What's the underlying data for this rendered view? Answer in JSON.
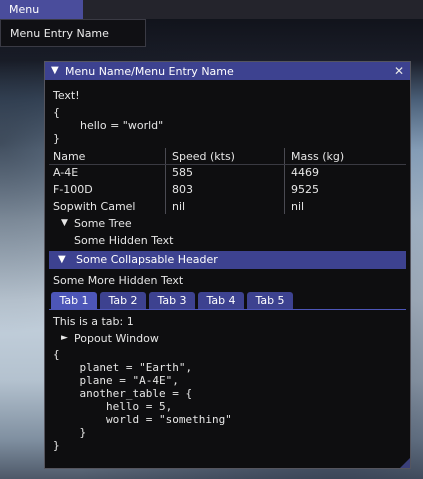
{
  "menubar": {
    "menu_title": "Menu Name",
    "entry": "Menu Entry Name"
  },
  "window": {
    "title": "Menu Name/Menu Entry Name",
    "close_glyph": "✕",
    "text_label": "Text!",
    "hello_block": {
      "open": "{",
      "line": "hello = \"world\"",
      "close": "}"
    },
    "table": {
      "headers": [
        "Name",
        "Speed (kts)",
        "Mass (kg)"
      ],
      "rows": [
        [
          "A-4E",
          "585",
          "4469"
        ],
        [
          "F-100D",
          "803",
          "9525"
        ],
        [
          "Sopwith Camel",
          "nil",
          "nil"
        ]
      ]
    },
    "tree": {
      "label": "Some Tree",
      "child": "Some Hidden Text"
    },
    "collapsable_header": "Some Collapsable Header",
    "more_text": "Some More Hidden Text",
    "tabs": [
      "Tab 1",
      "Tab 2",
      "Tab 3",
      "Tab 4",
      "Tab 5"
    ],
    "tab_content": "This is a tab: 1",
    "popout": "Popout Window",
    "code_lines": [
      "{",
      "    planet = \"Earth\",",
      "    plane = \"A-4E\",",
      "    another_table = {",
      "        hello = 5,",
      "        world = \"something\"",
      "    }",
      "}"
    ]
  }
}
